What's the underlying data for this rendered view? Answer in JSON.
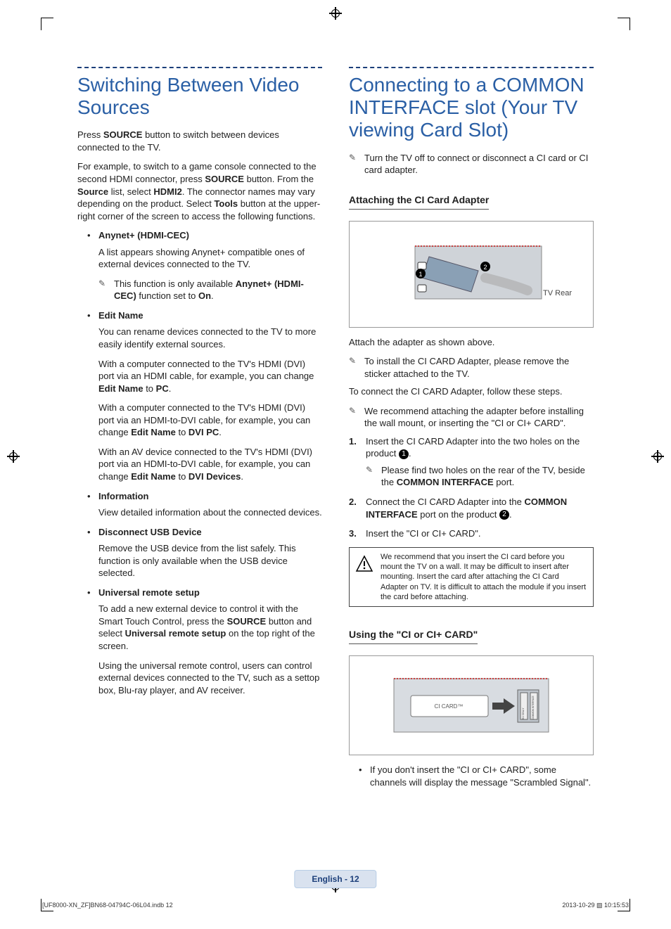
{
  "left": {
    "title": "Switching Between Video Sources",
    "intro1_a": "Press ",
    "intro1_b": "SOURCE",
    "intro1_c": " button to switch between devices connected to the TV.",
    "intro2_a": "For example, to switch to a game console connected to the second HDMI connector, press ",
    "intro2_b": "SOURCE",
    "intro2_c": " button. From the ",
    "intro2_d": "Source",
    "intro2_e": " list, select ",
    "intro2_f": "HDMI2",
    "intro2_g": ". The connector names may vary depending on the product. Select ",
    "intro2_h": "Tools",
    "intro2_i": " button at the upper-right corner of the screen to access the following functions.",
    "items": {
      "anynet": {
        "title": "Anynet+ (HDMI-CEC)",
        "p1": "A list appears showing Anynet+ compatible ones of external devices connected to the TV.",
        "note_a": "This function is only available ",
        "note_b": "Anynet+ (HDMI-CEC)",
        "note_c": " function set to ",
        "note_d": "On",
        "note_e": "."
      },
      "edit": {
        "title": "Edit Name",
        "p1": "You can rename devices connected to the TV to more easily identify external sources.",
        "p2_a": "With a computer connected to the TV's HDMI (DVI) port via an HDMI cable, for example, you can change ",
        "p2_b": "Edit Name",
        "p2_c": " to ",
        "p2_d": "PC",
        "p2_e": ".",
        "p3_a": "With a computer connected to the TV's HDMI (DVI) port via an HDMI-to-DVI cable, for example, you can change ",
        "p3_b": "Edit Name",
        "p3_c": " to ",
        "p3_d": "DVI PC",
        "p3_e": ".",
        "p4_a": "With an AV device connected to the TV's HDMI (DVI) port via an HDMI-to-DVI cable, for example, you can change ",
        "p4_b": "Edit Name",
        "p4_c": " to ",
        "p4_d": "DVI Devices",
        "p4_e": "."
      },
      "info": {
        "title": "Information",
        "p1": "View detailed information about the connected devices."
      },
      "usb": {
        "title": "Disconnect USB Device",
        "p1": "Remove the USB device from the list safely. This function is only available when the USB device selected."
      },
      "remote": {
        "title": "Universal remote setup",
        "p1_a": "To add a new external device to control it with the Smart Touch Control, press the ",
        "p1_b": "SOURCE",
        "p1_c": " button and select ",
        "p1_d": "Universal remote setup",
        "p1_e": " on the top right of the screen.",
        "p2": "Using the universal remote control, users can control external devices connected to the TV, such as a settop box, Blu-ray player, and AV receiver."
      }
    }
  },
  "right": {
    "title": "Connecting to a COMMON INTERFACE slot (Your TV viewing Card Slot)",
    "note_top": "Turn the TV off to connect or disconnect a CI card or CI card adapter.",
    "h_attach": "Attaching the CI Card Adapter",
    "tv_rear": "TV Rear",
    "after_fig": "Attach the adapter as shown above.",
    "note2": "To install the CI CARD Adapter, please remove the sticker attached to the TV.",
    "connect_intro": "To connect the CI CARD Adapter, follow these steps.",
    "note3": "We recommend attaching the adapter before installing the wall mount, or inserting the \"CI or CI+ CARD\".",
    "steps": {
      "s1_a": "Insert the CI CARD Adapter into the two holes on the product ",
      "s1_num": "1",
      "s1_b": ".",
      "s1_sub_a": "Please find two holes on the rear of the TV, beside the ",
      "s1_sub_b": "COMMON INTERFACE",
      "s1_sub_c": " port.",
      "s2_a": "Connect the CI CARD Adapter into the ",
      "s2_b": "COMMON INTERFACE",
      "s2_c": " port on the product ",
      "s2_num": "2",
      "s2_d": ".",
      "s3": "Insert the \"CI or CI+ CARD\"."
    },
    "warn": "We recommend that you insert the CI card before you mount the TV on a wall. It may be difficult to insert after mounting. Insert the card after attaching the CI Card Adapter on TV. It is difficult to attach the module if you insert the card before attaching.",
    "h_using": "Using the \"CI or CI+ CARD\"",
    "ci_card_label": "CI CARD™",
    "slot_label_a": "COMMON INTERFACE",
    "slot_label_b": "5V ONLY",
    "bullet1": "If you don't insert the \"CI or CI+ CARD\", some channels will display the message \"Scrambled Signal\"."
  },
  "footer": {
    "page": "English - 12",
    "print_left": "[UF8000-XN_ZF]BN68-04794C-06L04.indb   12",
    "print_right": "2013-10-29   ▧ 10:15:53"
  }
}
